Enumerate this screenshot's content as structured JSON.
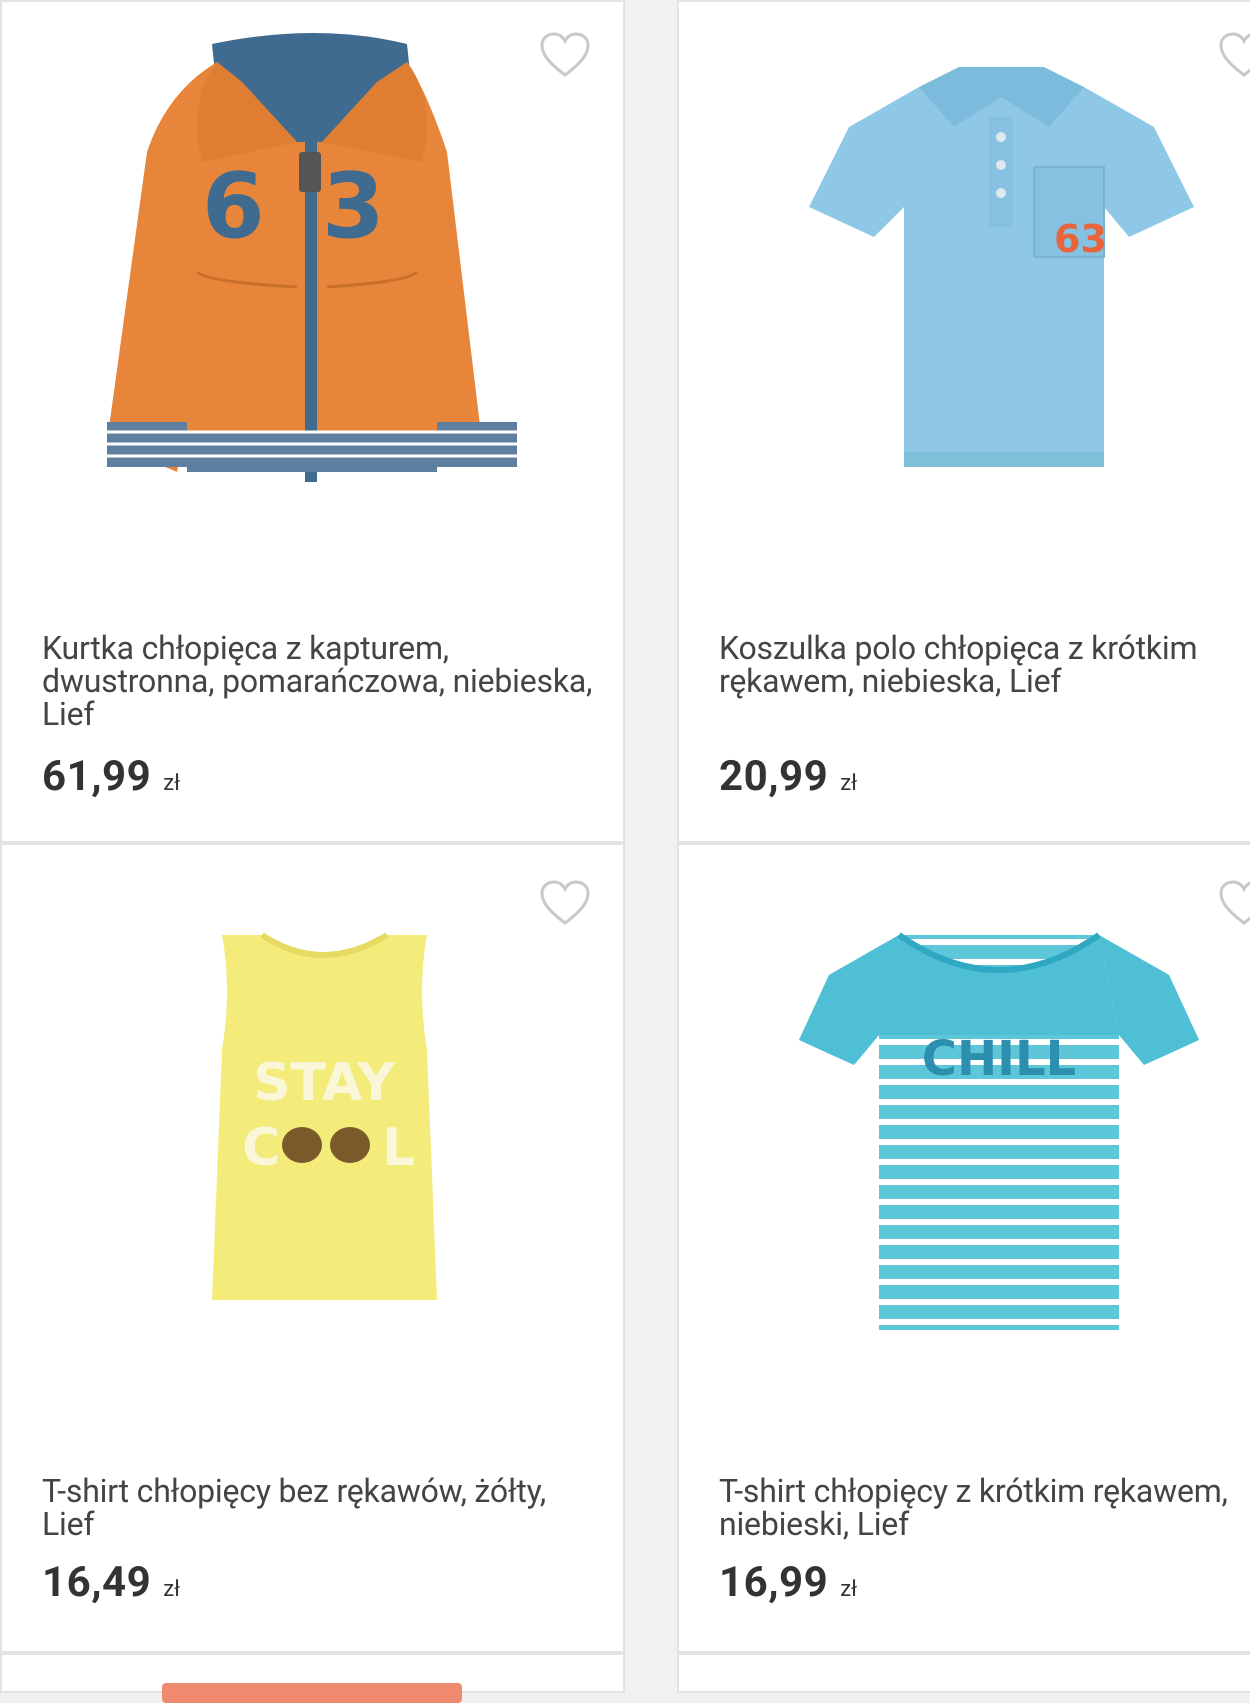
{
  "products": [
    {
      "title": "Kurtka chłopięca z kapturem, dwustronna, pomarańczowa, niebieska, Lief",
      "price": "61,99",
      "currency": "zł",
      "image": "orange-hoodie-image",
      "print_text": "63"
    },
    {
      "title": "Koszulka polo chłopięca z krótkim rękawem, niebieska, Lief",
      "price": "20,99",
      "currency": "zł",
      "image": "blue-polo-image",
      "print_text": "63"
    },
    {
      "title": "T-shirt chłopięcy bez rękawów, żółty, Lief",
      "price": "16,49",
      "currency": "zł",
      "image": "yellow-tank-image",
      "print_text": "STAY COOL"
    },
    {
      "title": "T-shirt chłopięcy z krótkim rękawem, niebieski, Lief",
      "price": "16,99",
      "currency": "zł",
      "image": "striped-tshirt-image",
      "print_text": "CHILL"
    }
  ],
  "colors": {
    "background": "#f1f1f1",
    "card": "#ffffff",
    "border": "#e3e3e3",
    "heart": "#c8c8c8"
  },
  "icons": {
    "favorite": "heart-outline-icon"
  }
}
